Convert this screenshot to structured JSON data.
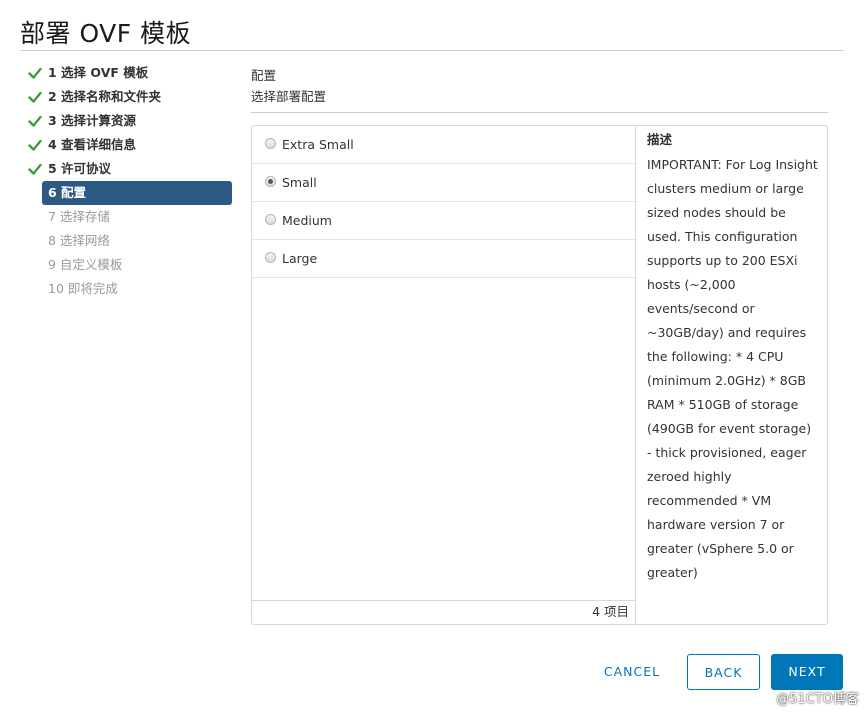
{
  "window": {
    "title": "部署 OVF 模板"
  },
  "steps": [
    {
      "label": "1 选择 OVF 模板",
      "state": "done"
    },
    {
      "label": "2 选择名称和文件夹",
      "state": "done"
    },
    {
      "label": "3 选择计算资源",
      "state": "done"
    },
    {
      "label": "4 查看详细信息",
      "state": "done"
    },
    {
      "label": "5 许可协议",
      "state": "done"
    },
    {
      "label": "6 配置",
      "state": "active"
    },
    {
      "label": "7 选择存储",
      "state": "disabled"
    },
    {
      "label": "8 选择网络",
      "state": "disabled"
    },
    {
      "label": "9 自定义模板",
      "state": "disabled"
    },
    {
      "label": "10 即将完成",
      "state": "disabled"
    }
  ],
  "section": {
    "title": "配置",
    "subtitle": "选择部署配置"
  },
  "options": [
    {
      "label": "Extra Small",
      "selected": false
    },
    {
      "label": "Small",
      "selected": true
    },
    {
      "label": "Medium",
      "selected": false
    },
    {
      "label": "Large",
      "selected": false
    }
  ],
  "list_footer": {
    "count_text": "4 项目"
  },
  "description": {
    "label": "描述",
    "text": "IMPORTANT: For Log Insight clusters medium or large sized nodes should be used. This configuration supports up to 200 ESXi hosts (~2,000 events/second or ~30GB/day) and requires the following: * 4 CPU (minimum 2.0GHz) * 8GB RAM * 510GB of storage (490GB for event storage) - thick provisioned, eager zeroed highly recommended * VM hardware version 7 or greater (vSphere 5.0 or greater)"
  },
  "buttons": {
    "cancel": "CANCEL",
    "back": "BACK",
    "next": "NEXT"
  },
  "watermark": "@51CTO博客",
  "colors": {
    "accent": "#0077b8",
    "active_step": "#2c5a85",
    "check": "#3c9d3c"
  },
  "icons": {
    "done": "check-icon"
  }
}
